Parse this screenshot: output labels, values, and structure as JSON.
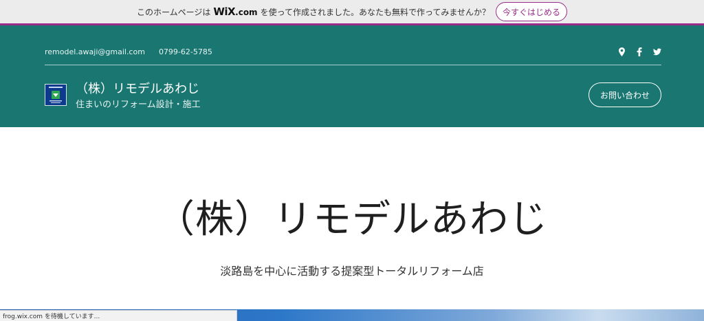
{
  "wix_banner": {
    "text_before": "このホームページは",
    "logo_wix": "WiX",
    "logo_com": ".com",
    "text_after": "を使って作成されました。あなたも無料で作ってみませんか？",
    "button_label": "今すぐはじめる"
  },
  "header": {
    "email": "remodel.awaji@gmail.com",
    "phone": "0799-62-5785",
    "site_name": "（株）リモデルあわじ",
    "tagline": "住まいのリフォーム設計・施工",
    "contact_button": "お問い合わせ",
    "social_icons": [
      "map-pin-icon",
      "facebook-icon",
      "twitter-icon"
    ]
  },
  "hero": {
    "title": "（株）リモデルあわじ",
    "subtitle": "淡路島を中心に活動する提案型トータルリフォーム店"
  },
  "status_bar": {
    "text": "frog.wix.com を待機しています..."
  },
  "colors": {
    "header_bg": "#197671",
    "wix_accent": "#9b2b8a"
  }
}
